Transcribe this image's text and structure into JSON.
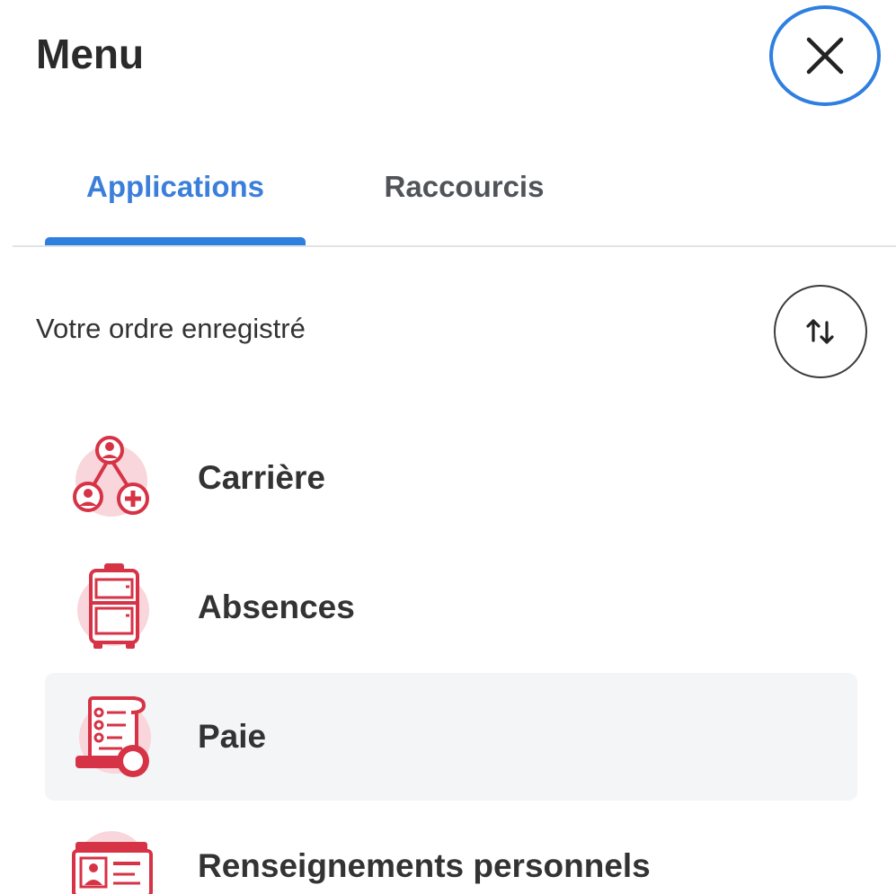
{
  "header": {
    "title": "Menu"
  },
  "tabs": [
    {
      "label": "Applications",
      "active": true
    },
    {
      "label": "Raccourcis",
      "active": false
    }
  ],
  "order": {
    "label": "Votre ordre enregistré"
  },
  "apps": [
    {
      "label": "Carrière",
      "icon": "career-network-icon",
      "selected": false
    },
    {
      "label": "Absences",
      "icon": "suitcase-icon",
      "selected": false
    },
    {
      "label": "Paie",
      "icon": "pay-scroll-icon",
      "selected": true
    },
    {
      "label": "Renseignements personnels",
      "icon": "id-card-icon",
      "selected": false
    }
  ],
  "colors": {
    "accent": "#2f7fe0",
    "icon_primary": "#d63346",
    "icon_bg": "#f8d6db",
    "selected_bg": "#f4f5f7"
  }
}
